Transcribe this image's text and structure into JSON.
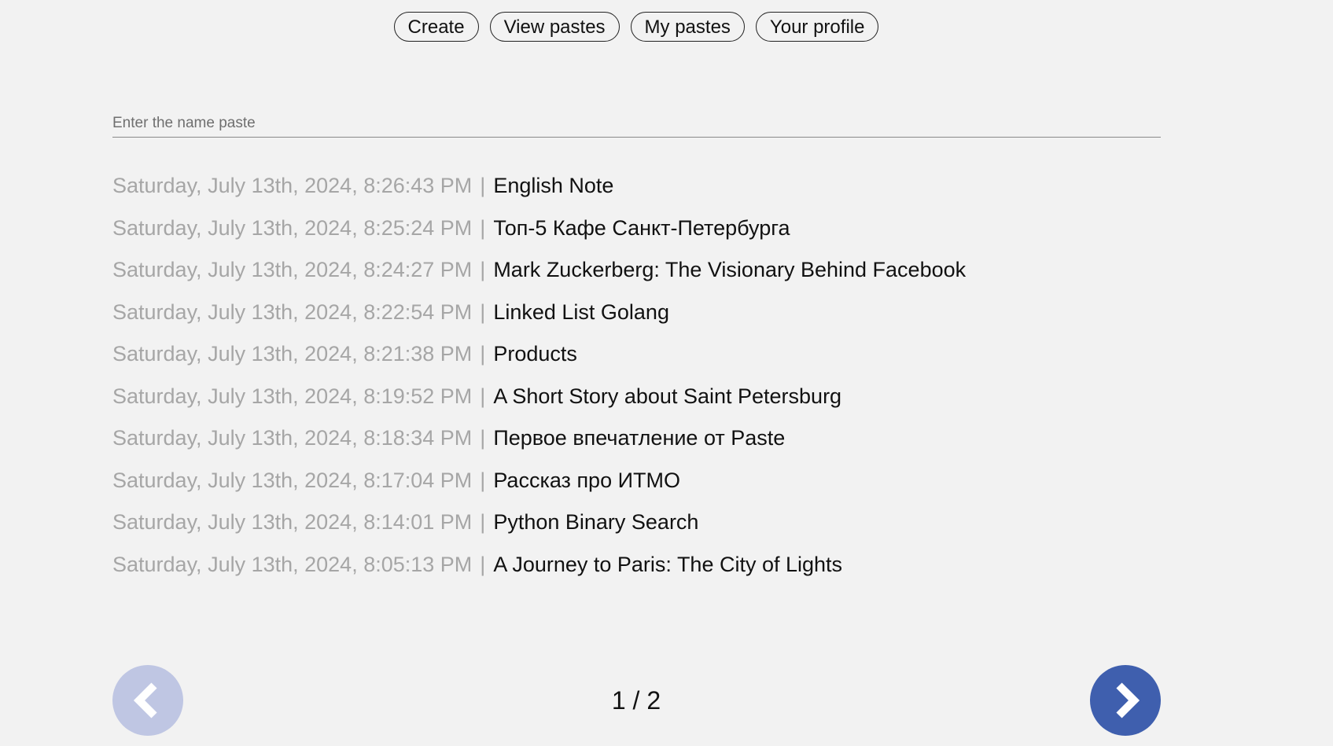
{
  "nav": {
    "create": "Create",
    "view_pastes": "View pastes",
    "my_pastes": "My pastes",
    "your_profile": "Your profile"
  },
  "search": {
    "placeholder": "Enter the name paste",
    "value": ""
  },
  "separator": "|",
  "pastes": [
    {
      "date": "Saturday, July 13th, 2024, 8:26:43 PM",
      "title": "English Note"
    },
    {
      "date": "Saturday, July 13th, 2024, 8:25:24 PM",
      "title": "Топ-5 Кафе Санкт-Петербурга"
    },
    {
      "date": "Saturday, July 13th, 2024, 8:24:27 PM",
      "title": "Mark Zuckerberg: The Visionary Behind Facebook"
    },
    {
      "date": "Saturday, July 13th, 2024, 8:22:54 PM",
      "title": "Linked List Golang"
    },
    {
      "date": "Saturday, July 13th, 2024, 8:21:38 PM",
      "title": "Products"
    },
    {
      "date": "Saturday, July 13th, 2024, 8:19:52 PM",
      "title": "A Short Story about Saint Petersburg"
    },
    {
      "date": "Saturday, July 13th, 2024, 8:18:34 PM",
      "title": "Первое впечатление от Paste"
    },
    {
      "date": "Saturday, July 13th, 2024, 8:17:04 PM",
      "title": "Рассказ про ИТМО"
    },
    {
      "date": "Saturday, July 13th, 2024, 8:14:01 PM",
      "title": "Python Binary Search"
    },
    {
      "date": "Saturday, July 13th, 2024, 8:05:13 PM",
      "title": "A Journey to Paris: The City of Lights"
    }
  ],
  "pagination": {
    "indicator": "1 / 2",
    "prev_icon": "chevron-left-icon",
    "next_icon": "chevron-right-icon",
    "prev_color": "#bfc6e3",
    "next_color": "#3f5fae"
  }
}
